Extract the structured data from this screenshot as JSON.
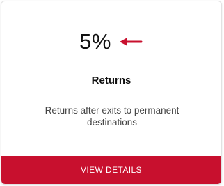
{
  "card": {
    "metric_value": "5%",
    "trend_icon": "arrow-left-icon",
    "title": "Returns",
    "description": "Returns after exits to permanent destinations",
    "button_label": "VIEW DETAILS"
  },
  "colors": {
    "accent": "#c8102e",
    "text": "#111111",
    "muted_text": "#444444"
  }
}
